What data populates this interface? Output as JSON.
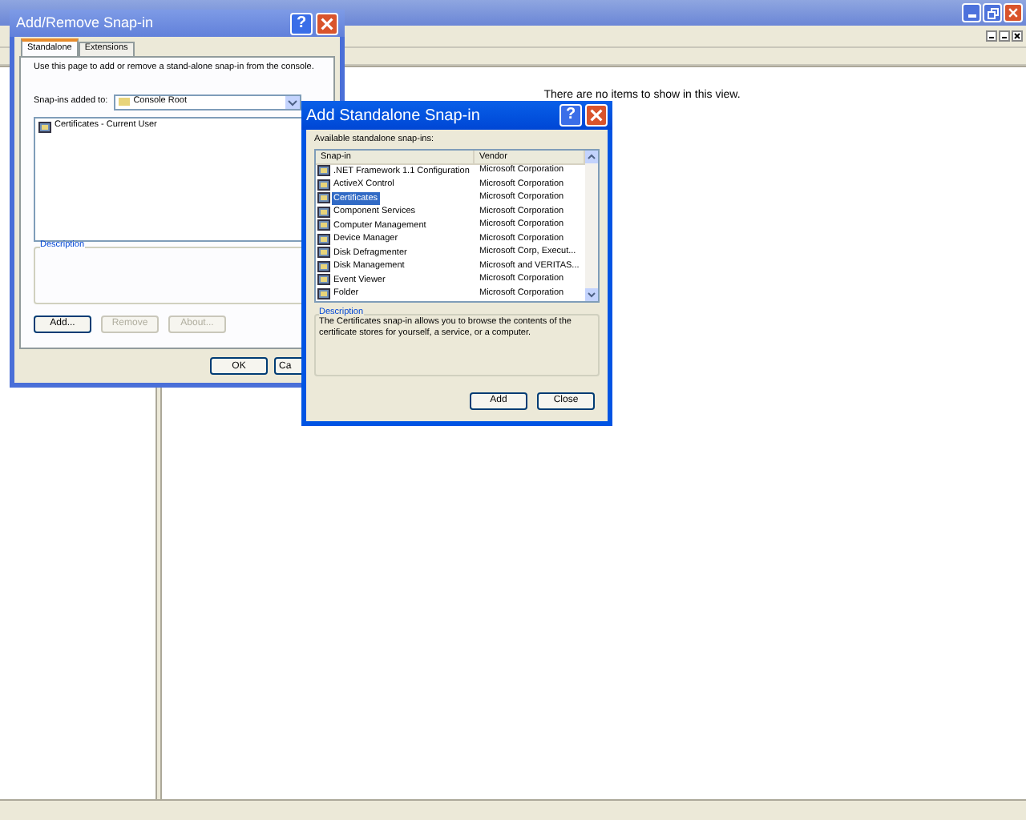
{
  "main_window": {
    "message": "There are no items to show in this view."
  },
  "add_remove_dialog": {
    "title": "Add/Remove Snap-in",
    "help": "?",
    "tabs": [
      {
        "label": "Standalone",
        "selected": true
      },
      {
        "label": "Extensions",
        "selected": false
      }
    ],
    "intro": "Use this page to add or remove a stand-alone snap-in from the console.",
    "added_to_label": "Snap-ins added to:",
    "added_to_value": "Console Root",
    "snapins": [
      "Certificates - Current User"
    ],
    "description_label": "Description",
    "list_buttons": [
      {
        "label": "Add...",
        "disabled": false
      },
      {
        "label": "Remove",
        "disabled": true
      },
      {
        "label": "About...",
        "disabled": true
      }
    ],
    "buttons": [
      "OK",
      "Ca"
    ]
  },
  "add_standalone_dialog": {
    "title": "Add Standalone Snap-in",
    "help": "?",
    "list_label": "Available standalone snap-ins:",
    "columns": [
      "Snap-in",
      "Vendor"
    ],
    "rows": [
      {
        "name": ".NET Framework 1.1 Configuration",
        "vendor": "Microsoft Corporation",
        "selected": false
      },
      {
        "name": "ActiveX Control",
        "vendor": "Microsoft Corporation",
        "selected": false
      },
      {
        "name": "Certificates",
        "vendor": "Microsoft Corporation",
        "selected": true
      },
      {
        "name": "Component Services",
        "vendor": "Microsoft Corporation",
        "selected": false
      },
      {
        "name": "Computer Management",
        "vendor": "Microsoft Corporation",
        "selected": false
      },
      {
        "name": "Device Manager",
        "vendor": "Microsoft Corporation",
        "selected": false
      },
      {
        "name": "Disk Defragmenter",
        "vendor": "Microsoft Corp, Execut...",
        "selected": false
      },
      {
        "name": "Disk Management",
        "vendor": "Microsoft and VERITAS...",
        "selected": false
      },
      {
        "name": "Event Viewer",
        "vendor": "Microsoft Corporation",
        "selected": false
      },
      {
        "name": "Folder",
        "vendor": "Microsoft Corporation",
        "selected": false
      }
    ],
    "description_label": "Description",
    "description": "The Certificates snap-in allows you to browse the contents of the certificate stores for yourself, a service, or a computer.",
    "buttons": [
      "Add",
      "Close"
    ]
  }
}
